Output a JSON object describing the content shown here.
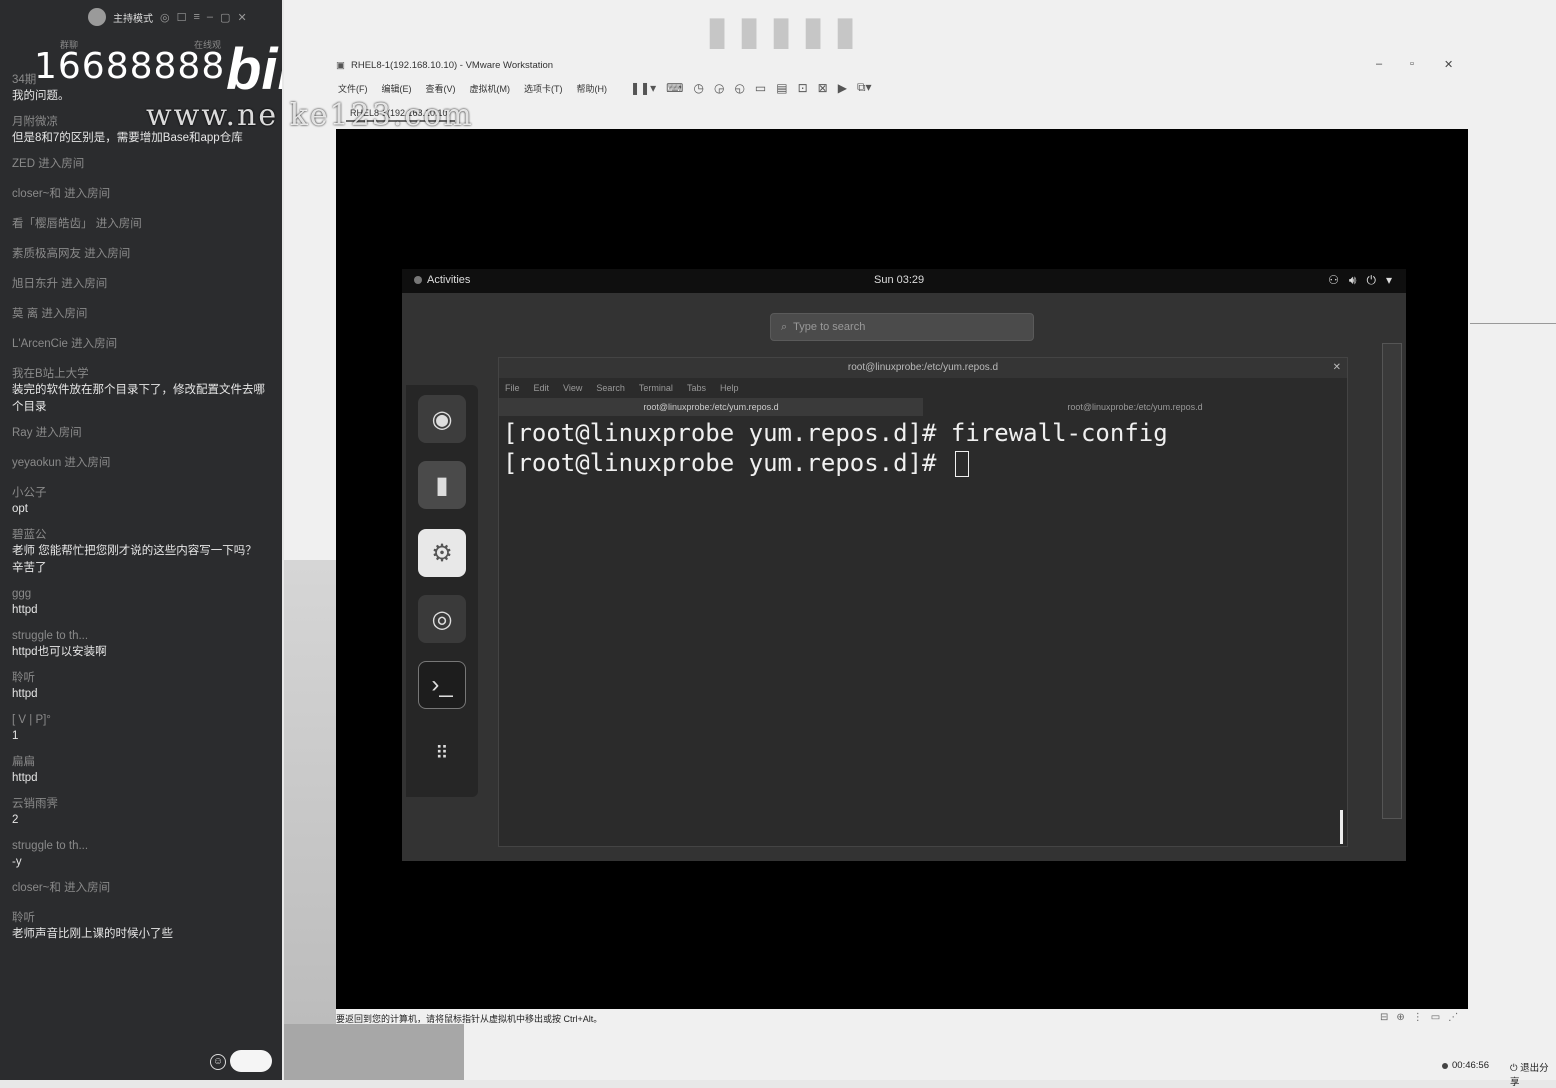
{
  "chat": {
    "mode_label": "主持模式",
    "overlay_number": "16688888",
    "overlay_logo": "bil",
    "tab_left": "群聊",
    "tab_right": "在线观",
    "messages": [
      {
        "user": "34期",
        "text": "我的问题。"
      },
      {
        "user": "月附微凉",
        "text": "但是8和7的区别是，需要增加Base和app仓库"
      },
      {
        "system": "ZED 进入房间"
      },
      {
        "system": "closer~和      进入房间"
      },
      {
        "system": "看「樱唇皓齿」 进入房间"
      },
      {
        "system": "素质极高网友 进入房间"
      },
      {
        "system": "旭日东升 进入房间"
      },
      {
        "system": "莫 离 进入房间"
      },
      {
        "system": "L'ArcenCie 进入房间"
      },
      {
        "user": "我在B站上大学",
        "text": "装完的软件放在那个目录下了，修改配置文件去哪个目录"
      },
      {
        "system": "Ray 进入房间"
      },
      {
        "system": "yeyaokun 进入房间"
      },
      {
        "user": "小公子",
        "text": "opt"
      },
      {
        "user": "碧蓝公",
        "text": "老师 您能帮忙把您刚才说的这些内容写一下吗？ 辛苦了"
      },
      {
        "user": "ggg",
        "text": "httpd"
      },
      {
        "user": "struggle to th...",
        "text": "httpd也可以安装啊"
      },
      {
        "user": "聆听",
        "text": "httpd"
      },
      {
        "user": "[    V    |     P]°",
        "text": "1"
      },
      {
        "user": "扁扁",
        "text": "httpd"
      },
      {
        "user": "云销雨霁",
        "text": "2"
      },
      {
        "user": "struggle to th...",
        "text": "-y"
      },
      {
        "system": "closer~和      进入房间"
      },
      {
        "user": "聆听",
        "text": "老师声音比刚上课的时候小了些"
      }
    ]
  },
  "watermarks": {
    "url": "www.ne   ke123.com"
  },
  "vmware": {
    "title": "RHEL8-1(192.168.10.10) - VMware Workstation",
    "menu": [
      "文件(F)",
      "编辑(E)",
      "查看(V)",
      "虚拟机(M)",
      "选项卡(T)",
      "帮助(H)"
    ],
    "tab_label": "RHEL8-1(192.168.10.10)",
    "status_text": "要返回到您的计算机，请将鼠标指针从虚拟机中移出或按 Ctrl+Alt。",
    "rec_time": "00:46:56",
    "exit_share": "退出分享"
  },
  "gnome": {
    "activities": "Activities",
    "clock": "Sun 03:29",
    "search_placeholder": "Type to search",
    "terminal": {
      "title": "root@linuxprobe:/etc/yum.repos.d",
      "menu": [
        "File",
        "Edit",
        "View",
        "Search",
        "Terminal",
        "Tabs",
        "Help"
      ],
      "tab1": "root@linuxprobe:/etc/yum.repos.d",
      "tab2": "root@linuxprobe:/etc/yum.repos.d",
      "lines": [
        "[root@linuxprobe yum.repos.d]# firewall-config",
        "[root@linuxprobe yum.repos.d]# "
      ]
    }
  }
}
